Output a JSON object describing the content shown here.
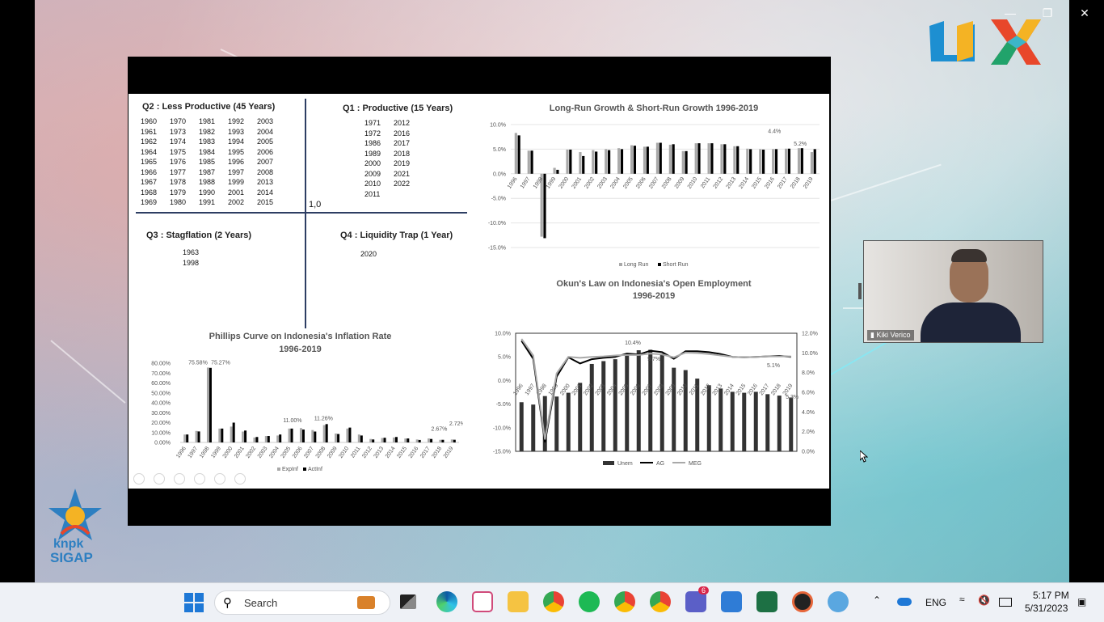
{
  "window": {
    "minimize": "—",
    "maximize": "❐",
    "close": "✕"
  },
  "quadrants": {
    "q2": {
      "title": "Q2 : Less Productive (45 Years)",
      "columns": [
        [
          "1960",
          "1961",
          "1962",
          "1964",
          "1965",
          "1966",
          "1967",
          "1968",
          "1969"
        ],
        [
          "1970",
          "1973",
          "1974",
          "1975",
          "1976",
          "1977",
          "1978",
          "1979",
          "1980"
        ],
        [
          "1981",
          "1982",
          "1983",
          "1984",
          "1985",
          "1987",
          "1988",
          "1990",
          "1991"
        ],
        [
          "1992",
          "1993",
          "1994",
          "1995",
          "1996",
          "1997",
          "1999",
          "2001",
          "2002"
        ],
        [
          "2003",
          "2004",
          "2005",
          "2006",
          "2007",
          "2008",
          "2013",
          "2014",
          "2015"
        ]
      ]
    },
    "q1": {
      "title": "Q1 : Productive (15 Years)",
      "columns": [
        [
          "1971",
          "1972",
          "1986",
          "1989",
          "2000",
          "2009",
          "2010",
          "2011"
        ],
        [
          "2012",
          "2016",
          "2017",
          "2018",
          "2019",
          "2021",
          "2022"
        ]
      ]
    },
    "q3": {
      "title": "Q3 : Stagflation (2 Years)",
      "years": [
        "1963",
        "1998"
      ]
    },
    "q4": {
      "title": "Q4 : Liquidity Trap (1 Year)",
      "years": [
        "2020"
      ]
    },
    "origin": "1,0"
  },
  "chart_data": [
    {
      "type": "bar",
      "title": "Long-Run Growth & Short-Run Growth 1996-2019",
      "categories": [
        "1996",
        "1997",
        "1998",
        "1999",
        "2000",
        "2001",
        "2002",
        "2003",
        "2004",
        "2005",
        "2006",
        "2007",
        "2008",
        "2009",
        "2010",
        "2011",
        "2012",
        "2013",
        "2014",
        "2015",
        "2016",
        "2017",
        "2018",
        "2019"
      ],
      "series": [
        {
          "name": "Long Run",
          "color": "#a9a9a9",
          "values": [
            8.3,
            4.7,
            -12.8,
            1.2,
            4.9,
            4.4,
            4.8,
            5.0,
            5.2,
            5.8,
            5.5,
            6.3,
            5.9,
            4.6,
            6.2,
            6.2,
            6.0,
            5.6,
            5.1,
            5.0,
            5.0,
            5.1,
            5.2,
            4.4
          ]
        },
        {
          "name": "Short Run",
          "color": "#000000",
          "values": [
            7.8,
            4.7,
            -13.1,
            0.8,
            4.9,
            3.6,
            4.5,
            4.8,
            5.0,
            5.7,
            5.5,
            6.3,
            6.0,
            4.6,
            6.2,
            6.2,
            6.0,
            5.6,
            5.0,
            4.9,
            5.0,
            5.1,
            5.2,
            5.0
          ]
        }
      ],
      "annotations": [
        "4.4%",
        "5.2%"
      ],
      "yticks": [
        "10.0%",
        "5.0%",
        "0.0%",
        "-5.0%",
        "-10.0%",
        "-15.0%"
      ],
      "ylim": [
        -15,
        10
      ]
    },
    {
      "type": "bar",
      "title": "Okun's Law on Indonesia's Open Employment",
      "subtitle": "1996-2019",
      "categories": [
        "1996",
        "1997",
        "1998",
        "1999",
        "2000",
        "2001",
        "2002",
        "2003",
        "2004",
        "2005",
        "2006",
        "2007",
        "2008",
        "2009",
        "2010",
        "2011",
        "2012",
        "2013",
        "2014",
        "2015",
        "2016",
        "2017",
        "2018",
        "2019"
      ],
      "bar_series": {
        "name": "Unem",
        "color": "#333333",
        "values": [
          -4.6,
          -5.1,
          -3.3,
          -3.4,
          -2.6,
          -0.5,
          3.5,
          4.1,
          4.5,
          5.6,
          6.4,
          6.5,
          5.7,
          2.7,
          2.2,
          0.4,
          -1.0,
          -1.7,
          -2.4,
          -2.6,
          -2.4,
          -2.9,
          -3.2,
          -3.6
        ]
      },
      "line_series": [
        {
          "name": "AG",
          "color": "#000000",
          "values": [
            8.4,
            4.6,
            -13.1,
            0.8,
            4.9,
            3.6,
            4.5,
            4.8,
            5.0,
            5.7,
            5.5,
            6.3,
            6.0,
            4.6,
            6.2,
            6.2,
            6.0,
            5.6,
            5.0,
            4.9,
            5.0,
            5.1,
            5.2,
            5.0
          ]
        },
        {
          "name": "MEG",
          "color": "#a9a9a9",
          "values": [
            8.8,
            5.3,
            -12.5,
            1.5,
            5.0,
            4.8,
            5.0,
            5.1,
            5.3,
            5.4,
            5.4,
            5.7,
            5.5,
            4.9,
            5.9,
            5.8,
            5.6,
            5.3,
            5.0,
            4.9,
            5.0,
            5.1,
            5.1,
            5.1
          ]
        }
      ],
      "annotations": [
        "10.4%",
        "9.7%",
        "5.1%",
        "5.3%"
      ],
      "yticks_left": [
        "10.0%",
        "5.0%",
        "0.0%",
        "-5.0%",
        "-10.0%",
        "-15.0%"
      ],
      "yticks_right": [
        "12.0%",
        "10.0%",
        "8.0%",
        "6.0%",
        "4.0%",
        "2.0%",
        "0.0%"
      ],
      "ylim": [
        -15,
        10
      ]
    },
    {
      "type": "bar",
      "title": "Phillips Curve on Indonesia's Inflation Rate",
      "subtitle": "1996-2019",
      "categories": [
        "1996",
        "1997",
        "1998",
        "1999",
        "2000",
        "2001",
        "2002",
        "2003",
        "2004",
        "2005",
        "2006",
        "2007",
        "2008",
        "2009",
        "2010",
        "2011",
        "2012",
        "2013",
        "2014",
        "2015",
        "2016",
        "2017",
        "2018",
        "2019"
      ],
      "series": [
        {
          "name": "ExpInf",
          "color": "#a9a9a9",
          "values": [
            8.0,
            11.6,
            75.58,
            14.0,
            16.0,
            11.0,
            5.0,
            6.5,
            7.0,
            14.0,
            14.5,
            12.5,
            17.5,
            9.0,
            14.0,
            8.0,
            3.5,
            4.5,
            5.0,
            4.0,
            3.0,
            4.0,
            2.67,
            3.0
          ]
        },
        {
          "name": "ActInf",
          "color": "#000000",
          "values": [
            8.0,
            11.1,
            75.27,
            14.0,
            20.0,
            12.0,
            5.5,
            6.5,
            8.0,
            14.0,
            13.0,
            11.0,
            18.5,
            8.5,
            15.0,
            7.0,
            3.0,
            4.7,
            5.5,
            4.0,
            2.5,
            3.5,
            2.67,
            2.72
          ]
        }
      ],
      "annotations": [
        "75.58%",
        "75.27%",
        "11.00%",
        "11.26%",
        "2.67%",
        "2.72%"
      ],
      "yticks": [
        "80.00%",
        "70.00%",
        "60.00%",
        "50.00%",
        "40.00%",
        "30.00%",
        "20.00%",
        "10.00%",
        "0.00%"
      ],
      "ylim": [
        0,
        80
      ]
    }
  ],
  "video": {
    "name": "Kiki Verico"
  },
  "taskbar": {
    "search_placeholder": "Search",
    "teams_badge": "6",
    "language": "ENG",
    "time": "5:17 PM",
    "date": "5/31/2023"
  },
  "logos": {
    "top_right": "SIGAP logo",
    "bottom_left": "knpk SIGAP",
    "bottom_left_text1": "knpk",
    "bottom_left_text2": "SIGAP"
  }
}
